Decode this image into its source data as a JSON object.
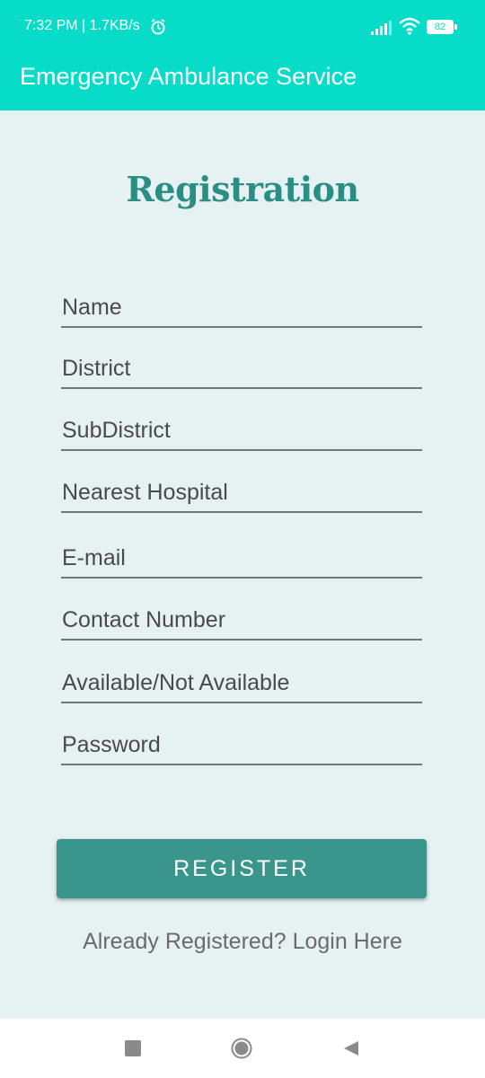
{
  "status_bar": {
    "time_net": "7:32 PM | 1.7KB/s",
    "battery": "82"
  },
  "app_bar": {
    "title": "Emergency Ambulance Service"
  },
  "form": {
    "heading": "Registration",
    "fields": [
      {
        "label": "Name"
      },
      {
        "label": "District"
      },
      {
        "label": "SubDistrict"
      },
      {
        "label": "Nearest Hospital"
      },
      {
        "label": "E-mail"
      },
      {
        "label": "Contact Number"
      },
      {
        "label": "Available/Not Available"
      },
      {
        "label": "Password"
      }
    ],
    "register_label": "REGISTER",
    "login_link": "Already Registered? Login Here"
  },
  "colors": {
    "primary": "#06dcc8",
    "accent": "#3a968c",
    "heading": "#2b8e84",
    "background": "#e6f2f2"
  },
  "icons": [
    "alarm-icon",
    "signal-icon",
    "wifi-icon",
    "battery-icon",
    "nav-recents-icon",
    "nav-home-icon",
    "nav-back-icon"
  ]
}
